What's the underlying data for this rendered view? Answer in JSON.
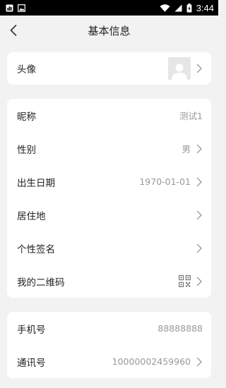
{
  "status_bar": {
    "time": "3:44",
    "icons": [
      "notification-icon",
      "image-icon",
      "wifi-icon",
      "signal-icon",
      "battery-icon"
    ]
  },
  "navbar": {
    "back_icon": "back-arrow-icon",
    "title": "基本信息"
  },
  "avatar_section": {
    "label": "头像",
    "avatar_icon": "avatar-placeholder-icon"
  },
  "profile_section": {
    "nickname": {
      "label": "昵称",
      "value": "测试1"
    },
    "gender": {
      "label": "性别",
      "value": "男"
    },
    "birthday": {
      "label": "出生日期",
      "value": "1970-01-01"
    },
    "residence": {
      "label": "居住地",
      "value": ""
    },
    "signature": {
      "label": "个性签名",
      "value": ""
    },
    "qrcode": {
      "label": "我的二维码",
      "icon": "qr-code-icon"
    }
  },
  "contact_section": {
    "phone": {
      "label": "手机号",
      "value": "88888888"
    },
    "comm_id": {
      "label": "通讯号",
      "value": "10000002459960"
    }
  },
  "colors": {
    "background": "#f2f2f2",
    "card": "#ffffff",
    "label_text": "#222222",
    "value_text": "#999999",
    "chevron": "#999999"
  }
}
